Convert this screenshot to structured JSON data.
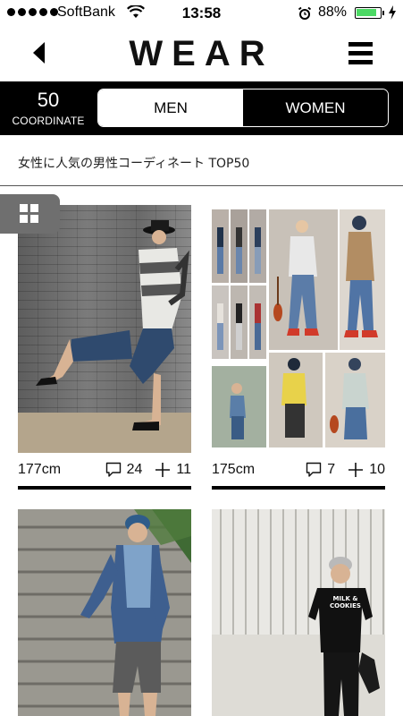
{
  "status_bar": {
    "carrier": "SoftBank",
    "time": "13:58",
    "battery_percent": "88%",
    "battery_level": 0.88,
    "battery_color": "#4cd964"
  },
  "nav": {
    "logo": "WEAR",
    "back_icon": "chevron-left-icon",
    "menu_icon": "hamburger-menu-icon"
  },
  "switch_bar": {
    "count": "50",
    "count_label": "COORDINATE",
    "options": [
      {
        "label": "MEN",
        "active": true
      },
      {
        "label": "WOMEN",
        "active": false
      }
    ]
  },
  "section": {
    "title": "女性に人気の男性コーディネート TOP50",
    "grid_icon": "grid-view-icon"
  },
  "cards": [
    {
      "height": "177cm",
      "comments": "24",
      "saves": "11"
    },
    {
      "height": "175cm",
      "comments": "7",
      "saves": "10"
    }
  ]
}
